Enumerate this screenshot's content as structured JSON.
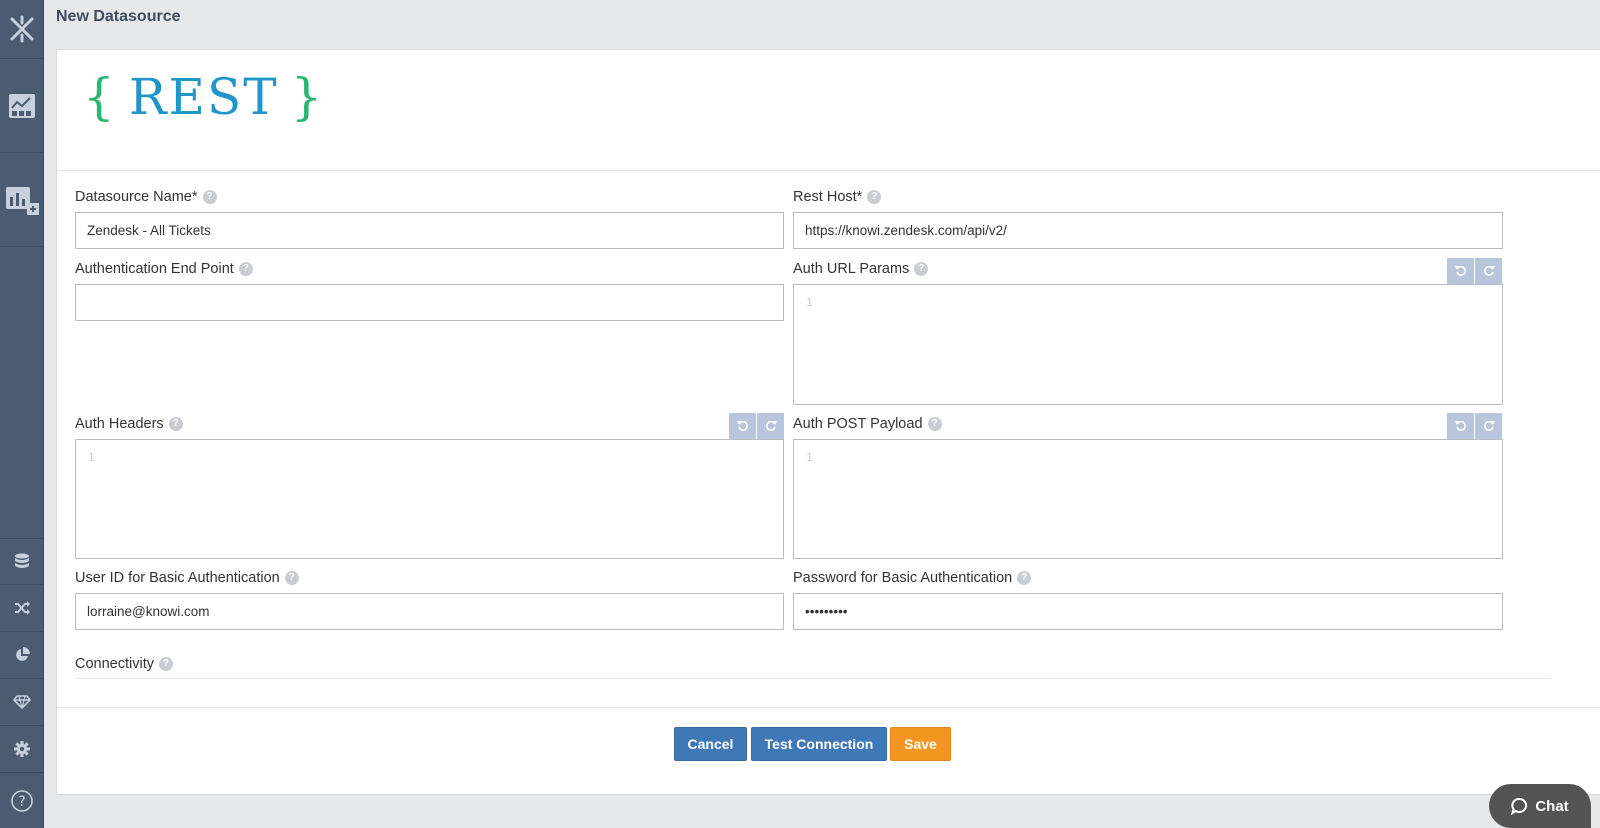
{
  "header": {
    "title": "New Datasource"
  },
  "logo": {
    "open_brace": "{",
    "word": "REST",
    "close_brace": "}"
  },
  "form": {
    "datasource_name": {
      "label": "Datasource Name*",
      "value": "Zendesk - All Tickets"
    },
    "rest_host": {
      "label": "Rest Host*",
      "value": "https://knowi.zendesk.com/api/v2/"
    },
    "auth_end_point": {
      "label": "Authentication End Point",
      "value": ""
    },
    "auth_url_params": {
      "label": "Auth URL Params",
      "line_number": "1"
    },
    "auth_headers": {
      "label": "Auth Headers",
      "line_number": "1"
    },
    "auth_post_payload": {
      "label": "Auth POST Payload",
      "line_number": "1"
    },
    "user_id": {
      "label": "User ID for Basic Authentication",
      "value": "lorraine@knowi.com"
    },
    "password": {
      "label": "Password for Basic Authentication",
      "value": "•••••••••"
    },
    "connectivity": {
      "label": "Connectivity"
    }
  },
  "help_glyph": "?",
  "buttons": {
    "cancel": "Cancel",
    "test_connection": "Test Connection",
    "save": "Save"
  },
  "chat": {
    "label": "Chat"
  },
  "sidebar": {
    "items": [
      {
        "icon": "knowi-logo-icon"
      },
      {
        "icon": "dashboard-icon"
      },
      {
        "icon": "add-widget-icon"
      },
      {
        "icon": "database-icon"
      },
      {
        "icon": "shuffle-icon"
      },
      {
        "icon": "pie-chart-icon"
      },
      {
        "icon": "diamond-icon"
      },
      {
        "icon": "gear-icon"
      },
      {
        "icon": "help-icon"
      }
    ]
  },
  "colors": {
    "sidebar": "#4a5b72",
    "primary_button": "#3f78b6",
    "save_button": "#f39621",
    "logo_brace": "#2bb673",
    "logo_word": "#1e97c8"
  }
}
